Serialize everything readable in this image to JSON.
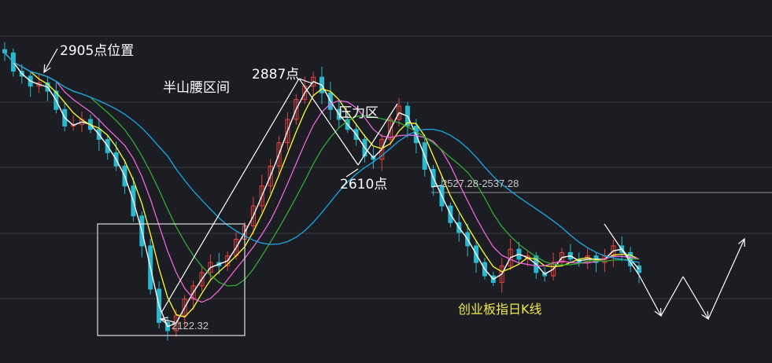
{
  "colors": {
    "background": "#1b1d22",
    "grid": "#3a3c42",
    "up": "#e8423c",
    "down": "#2ab8cf",
    "ma_white": "#ffffff",
    "ma_yellow": "#ffff33",
    "ma_pink": "#ee66dd",
    "ma_green": "#33aa33",
    "ma_blue": "#1ea7e6",
    "annotation": "#ffffff",
    "chart_title": "#f2e84a"
  },
  "annotations": {
    "high_2905": "2905点位置",
    "half_mountain": "半山腰区间",
    "high_2887": "2887点",
    "pressure_zone": "压力区",
    "low_2610": "2610点",
    "level_label": "2527.28-2537.28",
    "low_value": "2122.32",
    "chart_title": "创业板指日K线"
  },
  "chart_data": {
    "type": "candlestick",
    "title": "创业板指日K线",
    "series_note": "daily candles with moving averages (white, yellow, pink, green, blue)",
    "key_levels": [
      {
        "label": "2905点位置",
        "value": 2905
      },
      {
        "label": "2887点",
        "value": 2887
      },
      {
        "label": "2610点",
        "value": 2610
      },
      {
        "label": "2527.28-2537.28",
        "value": 2532.28
      },
      {
        "label": "2122.32",
        "value": 2122.32
      }
    ],
    "y_range": [
      2080,
      3100
    ],
    "horizontal_line": 2532.28,
    "close_path": [
      2960,
      2905,
      2890,
      2860,
      2870,
      2845,
      2790,
      2740,
      2745,
      2760,
      2730,
      2700,
      2660,
      2620,
      2560,
      2470,
      2380,
      2250,
      2150,
      2125,
      2170,
      2220,
      2260,
      2300,
      2330,
      2320,
      2350,
      2400,
      2440,
      2500,
      2560,
      2620,
      2690,
      2760,
      2820,
      2860,
      2887,
      2840,
      2790,
      2760,
      2730,
      2700,
      2650,
      2640,
      2700,
      2760,
      2800,
      2740,
      2690,
      2610,
      2560,
      2500,
      2450,
      2420,
      2380,
      2330,
      2290,
      2270,
      2320,
      2370,
      2340,
      2350,
      2300,
      2290,
      2330,
      2360,
      2340,
      2330,
      2350,
      2330,
      2350,
      2380,
      2360,
      2320,
      2300
    ],
    "projection_path": [
      2300,
      2200,
      2290,
      2180,
      2340
    ]
  }
}
